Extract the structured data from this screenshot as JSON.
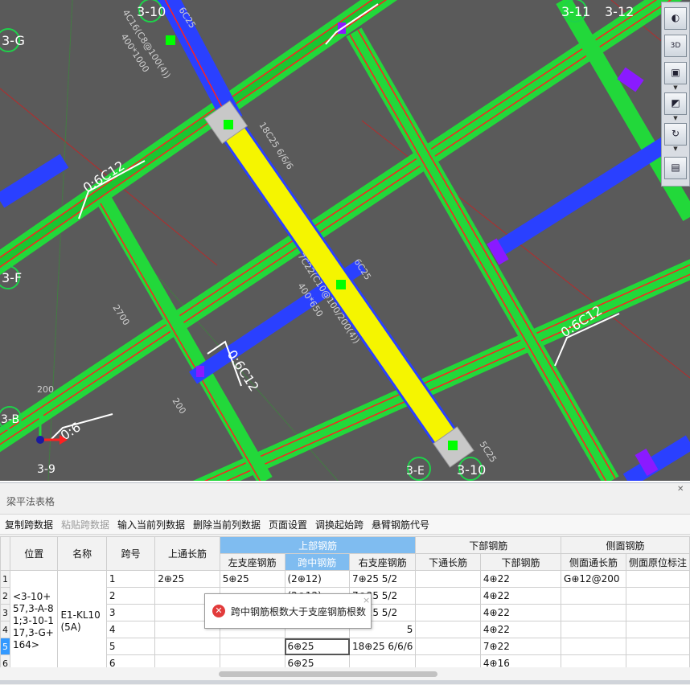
{
  "canvas": {
    "axis_labels": [
      "3-10",
      "3-11",
      "3-12",
      "3-G",
      "3-F",
      "3-G",
      "3-10"
    ],
    "axis_labels_partial": [
      "3-B",
      "3-E",
      "3-9"
    ],
    "rebar_annotations": {
      "beam_top_left": "0:6C12",
      "beam_right": "0:6C12",
      "beam_mid": "0:6C12",
      "beam_bottom_left": "0:6",
      "selected_beam_top": "18C25 6/6/6",
      "selected_beam_mid": "7C22(C10@100/200(4))",
      "selected_beam_size": "400*650",
      "selected_beam_right": "6C25",
      "column_top": "4C16(C8@100(4))",
      "column_size": "400*1000",
      "top_label_small": "6C25",
      "bottom_label_small": "5C25",
      "dim_2700": "2700",
      "dim_200a": "200",
      "dim_200b": "200"
    },
    "colors": {
      "background": "#5a5a5a",
      "beam_green": "#22d83a",
      "beam_blue": "#2a40ff",
      "selected_beam": "#f5f500",
      "rebar_red": "#ff2020",
      "annotation_white": "#ffffff",
      "annotation_cyan": "#1ea6c9"
    }
  },
  "view_toolbar": {
    "buttons": [
      "orbit-icon",
      "3d-view-icon",
      "cube-view-icon",
      "cube-front-icon",
      "rotate-icon",
      "layers-icon"
    ],
    "labels": {
      "three_d": "3D"
    }
  },
  "panel": {
    "title": "梁平法表格",
    "toolbar": {
      "copy_span": "复制跨数据",
      "paste_span": "粘贴跨数据",
      "input_column": "输入当前列数据",
      "delete_column": "删除当前列数据",
      "page_setup": "页面设置",
      "swap_start_span": "调换起始跨",
      "cantilever_code": "悬臂钢筋代号"
    },
    "table": {
      "group_headers": {
        "top_rebar": "上部钢筋",
        "bottom_rebar": "下部钢筋",
        "side_rebar": "侧面钢筋"
      },
      "columns": {
        "position": "位置",
        "name": "名称",
        "span": "跨号",
        "top_through": "上通长筋",
        "left_support": "左支座钢筋",
        "mid_span": "跨中钢筋",
        "right_support": "右支座钢筋",
        "bottom_through": "下通长筋",
        "bottom_rebar": "下部钢筋",
        "side_through": "侧面通长筋",
        "side_in_situ": "侧面原位标注"
      },
      "position_value": "<3-10+57,3-A-81;3-10-117,3-G+164>",
      "name_value": "E1-KL10(5A)",
      "rows": [
        {
          "no": "1",
          "span": "1",
          "top_through": "2⊕25",
          "left_support": "5⊕25",
          "mid_span": "(2⊕12)",
          "right_support": "7⊕25 5/2",
          "bottom_through": "",
          "bottom_rebar": "4⊕22",
          "side_through": "G⊕12@200",
          "side_in_situ": ""
        },
        {
          "no": "2",
          "span": "2",
          "top_through": "",
          "left_support": "",
          "mid_span": "(2⊕12)",
          "right_support": "7⊕25 5/2",
          "bottom_through": "",
          "bottom_rebar": "4⊕22",
          "side_through": "",
          "side_in_situ": ""
        },
        {
          "no": "3",
          "span": "3",
          "top_through": "",
          "left_support": "",
          "mid_span": "",
          "right_support": "7⊕25 5/2",
          "bottom_through": "",
          "bottom_rebar": "4⊕22",
          "side_through": "",
          "side_in_situ": ""
        },
        {
          "no": "4",
          "span": "4",
          "top_through": "",
          "left_support": "",
          "mid_span": "",
          "right_support": "5",
          "bottom_through": "",
          "bottom_rebar": "4⊕22",
          "side_through": "",
          "side_in_situ": ""
        },
        {
          "no": "5",
          "span": "5",
          "top_through": "",
          "left_support": "",
          "mid_span": "6⊕25",
          "right_support": "18⊕25 6/6/6",
          "bottom_through": "",
          "bottom_rebar": "7⊕22",
          "side_through": "",
          "side_in_situ": ""
        },
        {
          "no": "6",
          "span": "6",
          "top_through": "",
          "left_support": "",
          "mid_span": "6⊕25",
          "right_support": "",
          "bottom_through": "",
          "bottom_rebar": "4⊕16",
          "side_through": "",
          "side_in_situ": ""
        }
      ]
    },
    "tooltip": {
      "message": "跨中钢筋根数大于支座钢筋根数",
      "close": "×",
      "icon": "error-icon"
    }
  }
}
